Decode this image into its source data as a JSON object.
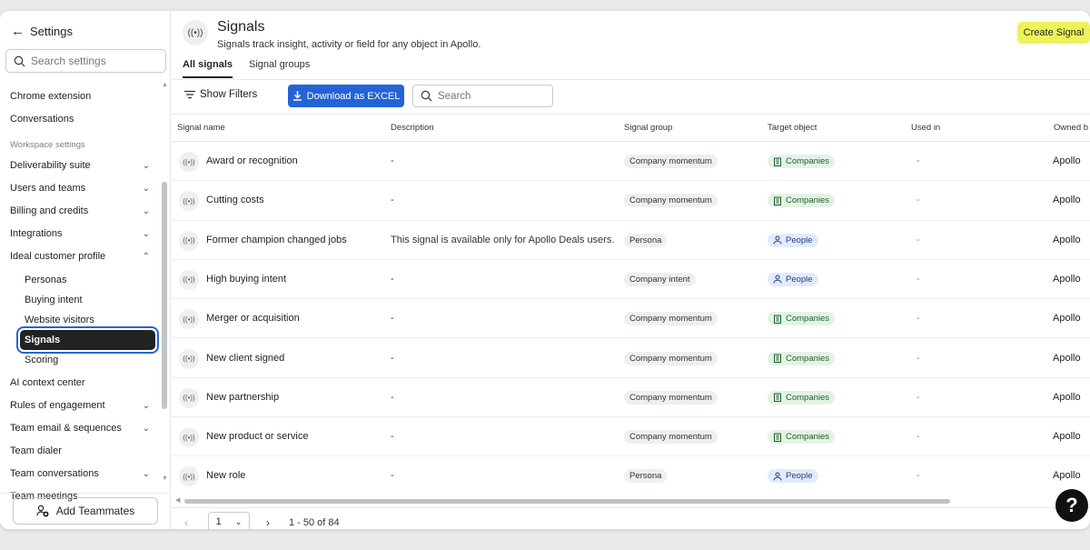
{
  "sidebar": {
    "back_label": "Settings",
    "search_placeholder": "Search settings",
    "items": [
      {
        "label": "Chrome extension",
        "top": 0
      },
      {
        "label": "Conversations"
      },
      {
        "section": "Workspace settings"
      },
      {
        "label": "Deliverability suite"
      },
      {
        "label": "Users and teams"
      },
      {
        "label": "Billing and credits"
      },
      {
        "label": "Integrations"
      },
      {
        "label": "Ideal customer profile"
      },
      {
        "label": "Personas"
      },
      {
        "label": "Buying intent"
      },
      {
        "label": "Website visitors"
      },
      {
        "label": "Signals"
      },
      {
        "label": "Scoring"
      },
      {
        "label": "AI context center"
      },
      {
        "label": "Rules of engagement"
      },
      {
        "label": "Team email & sequences"
      },
      {
        "label": "Team dialer"
      },
      {
        "label": "Team conversations"
      },
      {
        "label": "Team meetings"
      }
    ],
    "add_teammates_label": "Add Teammates"
  },
  "header": {
    "title": "Signals",
    "subtitle": "Signals track insight, activity or field for any object in Apollo.",
    "create_label": "Create Signal"
  },
  "tabs": [
    {
      "label": "All signals",
      "active": true
    },
    {
      "label": "Signal groups",
      "active": false
    }
  ],
  "toolbar": {
    "filters_label": "Show Filters",
    "download_label": "Download as EXCEL",
    "search_placeholder": "Search"
  },
  "table": {
    "columns": [
      "Signal name",
      "Description",
      "Signal group",
      "Target object",
      "Used in",
      "Owned b"
    ],
    "rows": [
      {
        "name": "Award or recognition",
        "description": "-",
        "group": "Company momentum",
        "target": "Companies",
        "used_in": "-",
        "owner": "Apollo"
      },
      {
        "name": "Cutting costs",
        "description": "-",
        "group": "Company momentum",
        "target": "Companies",
        "used_in": "-",
        "owner": "Apollo"
      },
      {
        "name": "Former champion changed jobs",
        "description": "This signal is available only for Apollo Deals users.",
        "group": "Persona",
        "target": "People",
        "used_in": "-",
        "owner": "Apollo"
      },
      {
        "name": "High buying intent",
        "description": "-",
        "group": "Company intent",
        "target": "People",
        "used_in": "-",
        "owner": "Apollo"
      },
      {
        "name": "Merger or acquisition",
        "description": "-",
        "group": "Company momentum",
        "target": "Companies",
        "used_in": "-",
        "owner": "Apollo"
      },
      {
        "name": "New client signed",
        "description": "-",
        "group": "Company momentum",
        "target": "Companies",
        "used_in": "-",
        "owner": "Apollo"
      },
      {
        "name": "New partnership",
        "description": "-",
        "group": "Company momentum",
        "target": "Companies",
        "used_in": "-",
        "owner": "Apollo"
      },
      {
        "name": "New product or service",
        "description": "-",
        "group": "Company momentum",
        "target": "Companies",
        "used_in": "-",
        "owner": "Apollo"
      },
      {
        "name": "New role",
        "description": "-",
        "group": "Persona",
        "target": "People",
        "used_in": "-",
        "owner": "Apollo"
      }
    ]
  },
  "pager": {
    "page": "1",
    "range": "1 - 50 of 84"
  },
  "help_label": "?",
  "colors": {
    "accent": "#2463d6",
    "create_button": "#eef25a",
    "companies_badge": "#e4f2e6",
    "people_badge": "#e3ebfa"
  }
}
